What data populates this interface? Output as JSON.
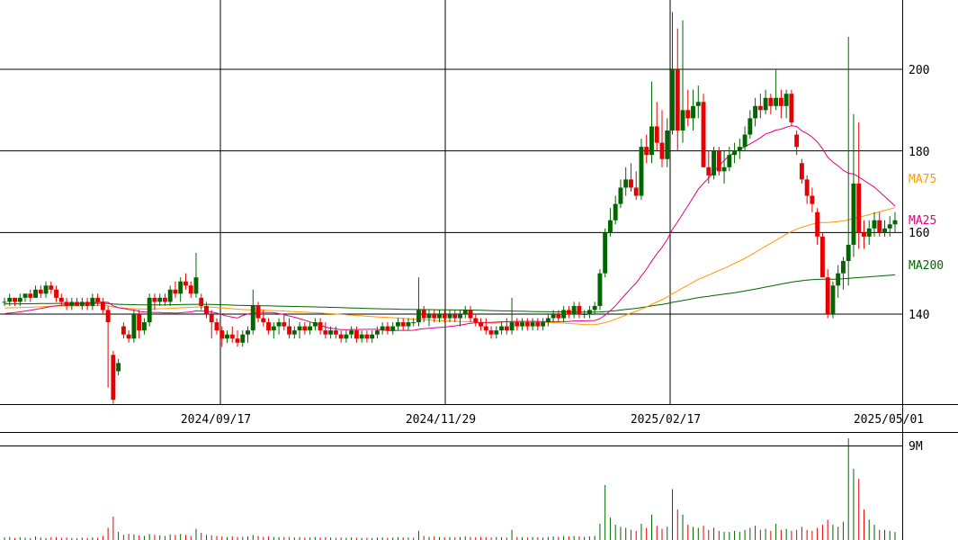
{
  "chart_data": {
    "type": "candlestick",
    "price_axis": {
      "ticks": [
        140,
        160,
        180,
        200
      ],
      "labels": [
        "140",
        "160",
        "180",
        "200"
      ],
      "range": [
        118,
        218
      ]
    },
    "date_axis": {
      "labels": [
        "2024/09/17",
        "2024/11/29",
        "2025/02/17",
        "2025/05/01"
      ]
    },
    "volume_axis": {
      "ticks": [
        "9M"
      ],
      "max": 10000000
    },
    "legend": {
      "ma75": "MA75",
      "ma25": "MA25",
      "ma200": "MA200"
    },
    "colors": {
      "up": "#006600",
      "down": "#e60000",
      "ma75": "#ff9900",
      "ma25": "#e6007e",
      "ma200": "#006600",
      "grid": "#000000",
      "text": "#000000"
    },
    "candles": [
      [
        143,
        144,
        142,
        143
      ],
      [
        143,
        145,
        142,
        144
      ],
      [
        144,
        144,
        142,
        143
      ],
      [
        143,
        145,
        142,
        144
      ],
      [
        144,
        145,
        143,
        145
      ],
      [
        145,
        146,
        143,
        144
      ],
      [
        144,
        147,
        144,
        146
      ],
      [
        146,
        147,
        144,
        145
      ],
      [
        145,
        148,
        144,
        147
      ],
      [
        147,
        148,
        145,
        146
      ],
      [
        146,
        147,
        143,
        144
      ],
      [
        144,
        145,
        142,
        143
      ],
      [
        143,
        144,
        141,
        142
      ],
      [
        142,
        144,
        141,
        143
      ],
      [
        143,
        144,
        142,
        142
      ],
      [
        142,
        144,
        141,
        143
      ],
      [
        143,
        144,
        141,
        142
      ],
      [
        142,
        145,
        141,
        144
      ],
      [
        144,
        145,
        142,
        143
      ],
      [
        143,
        144,
        140,
        141
      ],
      [
        141,
        142,
        122,
        138
      ],
      [
        130,
        131,
        118,
        119
      ],
      [
        126,
        129,
        125,
        128
      ],
      [
        137,
        138,
        134,
        135
      ],
      [
        135,
        136,
        133,
        134
      ],
      [
        134,
        141,
        133,
        140
      ],
      [
        140,
        141,
        134,
        136
      ],
      [
        136,
        139,
        135,
        138
      ],
      [
        138,
        145,
        137,
        144
      ],
      [
        144,
        145,
        141,
        143
      ],
      [
        143,
        145,
        142,
        144
      ],
      [
        144,
        145,
        142,
        143
      ],
      [
        143,
        147,
        142,
        146
      ],
      [
        146,
        148,
        144,
        145
      ],
      [
        145,
        149,
        143,
        148
      ],
      [
        148,
        150,
        146,
        147
      ],
      [
        147,
        148,
        144,
        145
      ],
      [
        145,
        155,
        144,
        149
      ],
      [
        144,
        145,
        141,
        142
      ],
      [
        142,
        143,
        139,
        140
      ],
      [
        140,
        141,
        134,
        138
      ],
      [
        138,
        139,
        135,
        136
      ],
      [
        136,
        137,
        132,
        134
      ],
      [
        134,
        136,
        133,
        135
      ],
      [
        135,
        137,
        133,
        134
      ],
      [
        134,
        136,
        132,
        133
      ],
      [
        133,
        136,
        132,
        135
      ],
      [
        135,
        137,
        133,
        136
      ],
      [
        136,
        146,
        135,
        142
      ],
      [
        142,
        143,
        138,
        139
      ],
      [
        139,
        141,
        137,
        138
      ],
      [
        138,
        139,
        135,
        136
      ],
      [
        136,
        138,
        134,
        137
      ],
      [
        137,
        139,
        135,
        138
      ],
      [
        138,
        140,
        136,
        137
      ],
      [
        137,
        139,
        134,
        135
      ],
      [
        135,
        137,
        134,
        136
      ],
      [
        136,
        138,
        134,
        137
      ],
      [
        137,
        138,
        135,
        136
      ],
      [
        136,
        138,
        135,
        137
      ],
      [
        137,
        139,
        136,
        138
      ],
      [
        138,
        139,
        135,
        136
      ],
      [
        136,
        138,
        134,
        135
      ],
      [
        135,
        137,
        134,
        136
      ],
      [
        136,
        137,
        134,
        135
      ],
      [
        135,
        136,
        133,
        134
      ],
      [
        134,
        136,
        133,
        135
      ],
      [
        135,
        137,
        134,
        136
      ],
      [
        136,
        137,
        133,
        134
      ],
      [
        134,
        136,
        133,
        135
      ],
      [
        135,
        136,
        133,
        134
      ],
      [
        134,
        136,
        133,
        135
      ],
      [
        135,
        137,
        134,
        136
      ],
      [
        136,
        138,
        135,
        137
      ],
      [
        137,
        138,
        135,
        136
      ],
      [
        136,
        138,
        135,
        137
      ],
      [
        137,
        139,
        136,
        138
      ],
      [
        138,
        139,
        136,
        137
      ],
      [
        137,
        139,
        136,
        138
      ],
      [
        138,
        139,
        137,
        138
      ],
      [
        138,
        149,
        137,
        141
      ],
      [
        141,
        142,
        138,
        139
      ],
      [
        139,
        141,
        137,
        140
      ],
      [
        140,
        141,
        138,
        139
      ],
      [
        139,
        141,
        138,
        140
      ],
      [
        140,
        141,
        138,
        139
      ],
      [
        139,
        141,
        138,
        140
      ],
      [
        140,
        141,
        138,
        139
      ],
      [
        139,
        141,
        137,
        140
      ],
      [
        140,
        142,
        139,
        141
      ],
      [
        141,
        142,
        138,
        139
      ],
      [
        139,
        140,
        137,
        138
      ],
      [
        138,
        139,
        136,
        137
      ],
      [
        137,
        139,
        135,
        136
      ],
      [
        136,
        137,
        134,
        135
      ],
      [
        135,
        137,
        134,
        136
      ],
      [
        136,
        138,
        135,
        137
      ],
      [
        137,
        139,
        135,
        136
      ],
      [
        136,
        144,
        135,
        138
      ],
      [
        138,
        139,
        136,
        137
      ],
      [
        137,
        139,
        136,
        138
      ],
      [
        138,
        139,
        136,
        137
      ],
      [
        137,
        139,
        136,
        138
      ],
      [
        138,
        139,
        136,
        137
      ],
      [
        137,
        139,
        136,
        138
      ],
      [
        138,
        140,
        137,
        139
      ],
      [
        139,
        141,
        138,
        140
      ],
      [
        140,
        141,
        138,
        139
      ],
      [
        139,
        142,
        138,
        141
      ],
      [
        141,
        142,
        139,
        140
      ],
      [
        140,
        143,
        139,
        142
      ],
      [
        142,
        143,
        139,
        140
      ],
      [
        140,
        141,
        139,
        140
      ],
      [
        140,
        142,
        139,
        141
      ],
      [
        141,
        143,
        140,
        142
      ],
      [
        142,
        151,
        141,
        150
      ],
      [
        150,
        161,
        149,
        160
      ],
      [
        160,
        166,
        159,
        163
      ],
      [
        163,
        169,
        162,
        167
      ],
      [
        167,
        173,
        166,
        171
      ],
      [
        171,
        176,
        169,
        173
      ],
      [
        173,
        177,
        170,
        171
      ],
      [
        171,
        175,
        168,
        169
      ],
      [
        169,
        183,
        168,
        181
      ],
      [
        181,
        184,
        177,
        179
      ],
      [
        179,
        197,
        177,
        186
      ],
      [
        186,
        192,
        180,
        182
      ],
      [
        182,
        190,
        176,
        178
      ],
      [
        178,
        188,
        176,
        185
      ],
      [
        185,
        214,
        184,
        200
      ],
      [
        200,
        210,
        180,
        185
      ],
      [
        185,
        212,
        182,
        190
      ],
      [
        190,
        195,
        186,
        188
      ],
      [
        188,
        195,
        185,
        191
      ],
      [
        191,
        196,
        188,
        192
      ],
      [
        192,
        194,
        176,
        176
      ],
      [
        176,
        180,
        172,
        174
      ],
      [
        174,
        181,
        173,
        180
      ],
      [
        180,
        181,
        174,
        175
      ],
      [
        175,
        180,
        172,
        176
      ],
      [
        176,
        181,
        175,
        179
      ],
      [
        179,
        182,
        177,
        180
      ],
      [
        180,
        183,
        178,
        181
      ],
      [
        181,
        186,
        180,
        184
      ],
      [
        184,
        190,
        183,
        188
      ],
      [
        188,
        193,
        186,
        191
      ],
      [
        191,
        194,
        188,
        190
      ],
      [
        190,
        195,
        189,
        193
      ],
      [
        193,
        194,
        189,
        191
      ],
      [
        191,
        200,
        190,
        193
      ],
      [
        193,
        195,
        188,
        191
      ],
      [
        191,
        195,
        188,
        194
      ],
      [
        194,
        195,
        186,
        187
      ],
      [
        184,
        185,
        179,
        181
      ],
      [
        177,
        178,
        172,
        173
      ],
      [
        173,
        174,
        167,
        169
      ],
      [
        169,
        171,
        165,
        167
      ],
      [
        165,
        166,
        157,
        159
      ],
      [
        159,
        160,
        152,
        149
      ],
      [
        149,
        151,
        139,
        140
      ],
      [
        140,
        148,
        139,
        147
      ],
      [
        147,
        152,
        144,
        150
      ],
      [
        150,
        154,
        146,
        153
      ],
      [
        153,
        208,
        147,
        157
      ],
      [
        157,
        189,
        154,
        172
      ],
      [
        172,
        187,
        156,
        160
      ],
      [
        160,
        163,
        156,
        159
      ],
      [
        159,
        163,
        157,
        161
      ],
      [
        161,
        165,
        159,
        163
      ],
      [
        163,
        165,
        159,
        160
      ],
      [
        160,
        163,
        159,
        161
      ],
      [
        161,
        164,
        159,
        162
      ],
      [
        162,
        165,
        160,
        163
      ]
    ],
    "volumes": [
      0.25,
      0.3,
      0.2,
      0.28,
      0.22,
      0.2,
      0.35,
      0.25,
      0.2,
      0.3,
      0.28,
      0.22,
      0.25,
      0.2,
      0.18,
      0.24,
      0.2,
      0.25,
      0.22,
      0.4,
      1.2,
      2.3,
      0.8,
      0.5,
      0.6,
      0.55,
      0.45,
      0.4,
      0.6,
      0.5,
      0.45,
      0.4,
      0.55,
      0.5,
      0.6,
      0.5,
      0.4,
      1.1,
      0.7,
      0.5,
      0.45,
      0.4,
      0.35,
      0.3,
      0.35,
      0.3,
      0.3,
      0.35,
      0.5,
      0.4,
      0.3,
      0.35,
      0.3,
      0.28,
      0.3,
      0.3,
      0.25,
      0.28,
      0.25,
      0.25,
      0.3,
      0.25,
      0.28,
      0.25,
      0.22,
      0.25,
      0.22,
      0.25,
      0.22,
      0.2,
      0.22,
      0.2,
      0.25,
      0.25,
      0.22,
      0.25,
      0.28,
      0.25,
      0.25,
      0.22,
      0.9,
      0.4,
      0.3,
      0.35,
      0.3,
      0.28,
      0.3,
      0.28,
      0.3,
      0.35,
      0.3,
      0.28,
      0.3,
      0.28,
      0.25,
      0.3,
      0.28,
      0.25,
      1.0,
      0.3,
      0.28,
      0.25,
      0.3,
      0.28,
      0.25,
      0.3,
      0.35,
      0.3,
      0.4,
      0.35,
      0.4,
      0.35,
      0.3,
      0.35,
      0.4,
      1.6,
      5.4,
      2.2,
      1.5,
      1.3,
      1.2,
      1.0,
      0.9,
      1.6,
      1.2,
      2.5,
      1.4,
      1.1,
      1.3,
      5.0,
      3.0,
      2.5,
      1.5,
      1.3,
      1.2,
      1.4,
      1.0,
      1.2,
      0.9,
      0.8,
      0.8,
      0.9,
      0.8,
      1.0,
      1.2,
      1.4,
      1.0,
      1.1,
      0.9,
      1.6,
      1.0,
      1.1,
      0.9,
      1.0,
      1.3,
      1.0,
      0.9,
      1.2,
      1.5,
      2.0,
      1.5,
      1.3,
      1.8,
      10.0,
      7.0,
      6.0,
      3.0,
      2.0,
      1.5,
      1.0,
      1.0,
      0.9,
      0.8
    ]
  }
}
